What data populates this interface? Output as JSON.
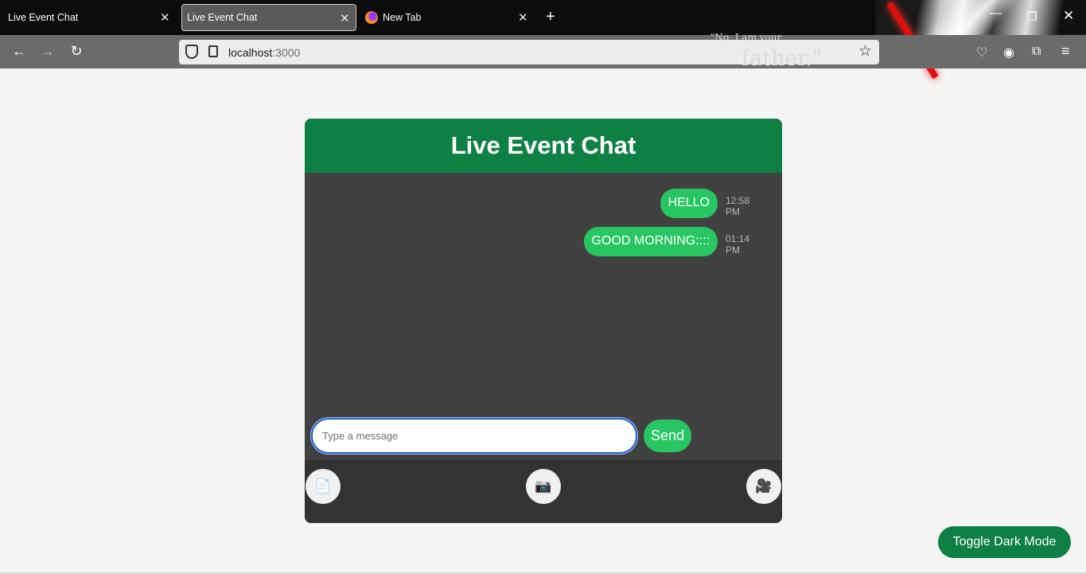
{
  "browser": {
    "tabs": [
      {
        "title": "Live Event Chat",
        "active": false
      },
      {
        "title": "Live Event Chat",
        "active": true
      },
      {
        "title": "New Tab",
        "active": false
      }
    ],
    "tab_close": "✕",
    "new_tab": "+",
    "url_host": "localhost",
    "url_port": ":3000",
    "theme_quote_line1": "\"No, I am your",
    "theme_quote_line2": "father.\"",
    "icons": {
      "back": "←",
      "forward": "→",
      "reload": "↻",
      "bookmark": "☆",
      "minimize": "—",
      "maximize": "❐",
      "close": "✕",
      "pocket": "♡",
      "account": "◉",
      "extensions": "⧉",
      "menu": "≡"
    }
  },
  "chat": {
    "title": "Live Event Chat",
    "messages": [
      {
        "text": "HELLO",
        "time": "12:58 PM"
      },
      {
        "text": "GOOD MORNING::::",
        "time": "01:14 PM"
      }
    ],
    "input_placeholder": "Type a message",
    "send_label": "Send",
    "attachments": [
      {
        "name": "document-icon",
        "glyph": "📄"
      },
      {
        "name": "camera-icon",
        "glyph": "📷"
      },
      {
        "name": "video-camera-icon",
        "glyph": "🎥"
      }
    ]
  },
  "page": {
    "toggle_label": "Toggle Dark Mode"
  },
  "colors": {
    "accent_green": "#0e8043",
    "bubble_green": "#27c663",
    "chat_bg": "#414141"
  }
}
